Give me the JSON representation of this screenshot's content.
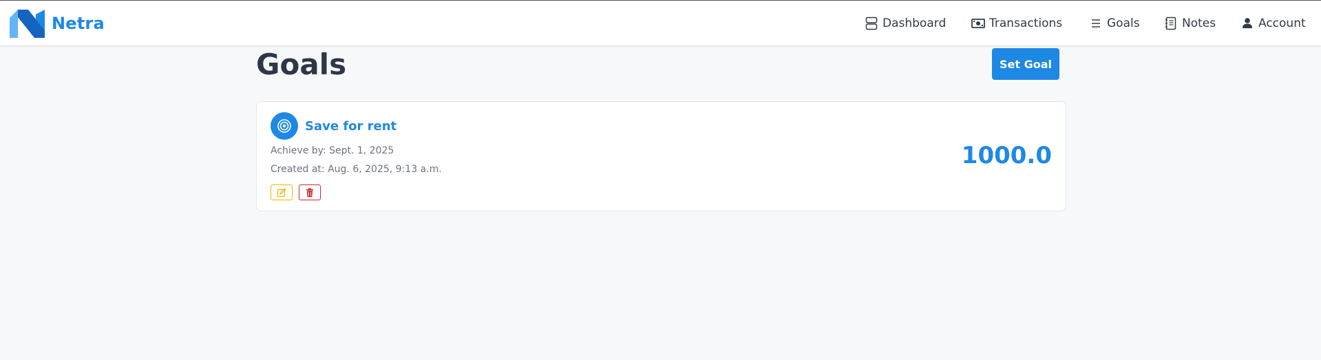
{
  "app": {
    "brand_name": "Netra"
  },
  "nav": {
    "items": [
      {
        "label": "Dashboard",
        "icon": "dashboard-icon"
      },
      {
        "label": "Transactions",
        "icon": "cash-icon"
      },
      {
        "label": "Goals",
        "icon": "list-icon"
      },
      {
        "label": "Notes",
        "icon": "notebook-icon"
      },
      {
        "label": "Account",
        "icon": "person-icon"
      }
    ]
  },
  "page": {
    "title": "Goals",
    "set_goal_label": "Set Goal"
  },
  "goals": [
    {
      "name": "Save for rent",
      "achieve_by": "Achieve by: Sept. 1, 2025",
      "created_at": "Created at: Aug. 6, 2025, 9:13 a.m.",
      "amount": "1000.0",
      "icon": "target-icon"
    }
  ],
  "colors": {
    "accent": "#1e88e5",
    "edit": "#f0b400",
    "delete": "#c62828",
    "background": "#f7f8fa"
  }
}
